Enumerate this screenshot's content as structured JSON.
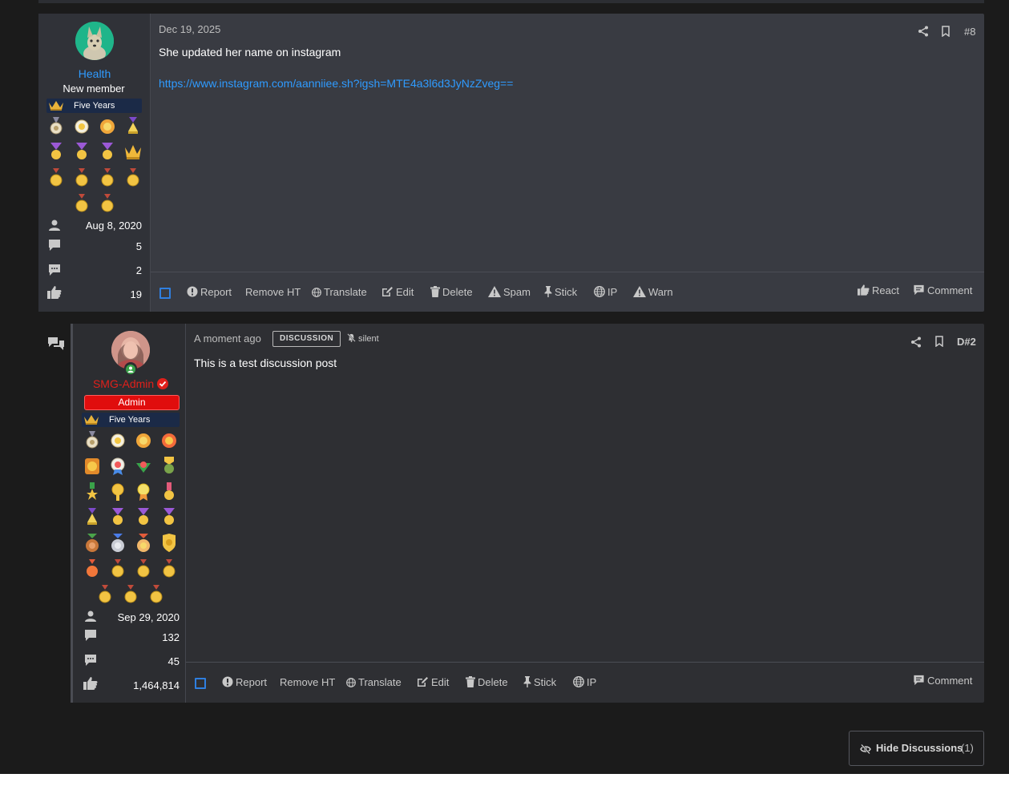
{
  "post1": {
    "date": "Dec 19, 2025",
    "post_number": "#8",
    "body_text": "She updated her name on instagram",
    "link_text": "https://www.instagram.com/aanniiee.sh?igsh=MTE4a3l6d3JyNzZveg==",
    "user": {
      "name": "Health",
      "title": "New member",
      "banner": "Five Years",
      "joined": "Aug 8, 2020",
      "messages": "5",
      "discussions": "2",
      "reactions": "19"
    },
    "actions": {
      "report": "Report",
      "remove_ht": "Remove HT",
      "translate": "Translate",
      "edit": "Edit",
      "delete": "Delete",
      "spam": "Spam",
      "stick": "Stick",
      "ip": "IP",
      "warn": "Warn",
      "react": "React",
      "comment": "Comment"
    }
  },
  "post2": {
    "date": "A moment ago",
    "badge": "DISCUSSION",
    "silent": "silent",
    "post_number": "D#2",
    "body_text": "This is a test discussion post",
    "user": {
      "name": "SMG-Admin",
      "role": "Admin",
      "banner": "Five Years",
      "joined": "Sep 29, 2020",
      "messages": "132",
      "discussions": "45",
      "reactions": "1,464,814"
    },
    "actions": {
      "report": "Report",
      "remove_ht": "Remove HT",
      "translate": "Translate",
      "edit": "Edit",
      "delete": "Delete",
      "stick": "Stick",
      "ip": "IP",
      "comment": "Comment"
    }
  },
  "hide_discussions": {
    "label": "Hide Discussions",
    "count": "(1)"
  },
  "colors": {
    "background": "#1b1b1b",
    "post_bg": "#393b42",
    "link": "#2f9bff",
    "admin_red": "#e00d0d"
  }
}
